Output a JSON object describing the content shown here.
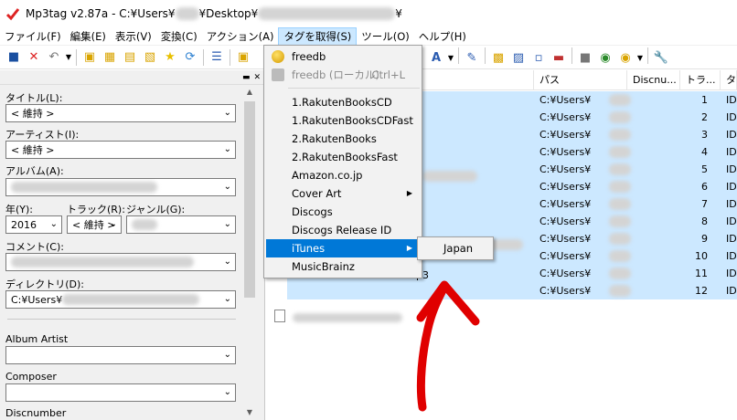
{
  "window": {
    "title": "Mp3tag v2.87a  -  C:¥Users¥",
    "title_mid": "¥Desktop¥",
    "title_end": "¥"
  },
  "menubar": [
    "ファイル(F)",
    "編集(E)",
    "表示(V)",
    "変換(C)",
    "アクション(A)",
    "タグを取得(S)",
    "ツール(O)",
    "ヘルプ(H)"
  ],
  "toolbar": {
    "icons": [
      "save-icon",
      "remove-tag-icon",
      "undo-icon",
      "open-folder-icon",
      "add-folder-icon",
      "favorite-icon",
      "refresh-icon",
      "tag-panel-icon"
    ]
  },
  "left_panel": {
    "title": {
      "label": "タイトル(L):",
      "value": "< 維持 >"
    },
    "artist": {
      "label": "アーティスト(I):",
      "value": "< 維持 >"
    },
    "album": {
      "label": "アルバム(A):",
      "value": ""
    },
    "year": {
      "label": "年(Y):",
      "value": "2016"
    },
    "track": {
      "label": "トラック(R):",
      "value": "< 維持 >"
    },
    "genre": {
      "label": "ジャンル(G):",
      "value": ""
    },
    "comment": {
      "label": "コメント(C):",
      "value": ""
    },
    "directory": {
      "label": "ディレクトリ(D):",
      "value": "C:¥Users¥"
    },
    "album_artist": {
      "label": "Album Artist",
      "value": ""
    },
    "composer": {
      "label": "Composer",
      "value": ""
    },
    "discnumber": {
      "label": "Discnumber"
    }
  },
  "file_list": {
    "columns": [
      "パス",
      "Discnu...",
      "トラ...",
      "タ"
    ],
    "rows": [
      {
        "path": "C:¥Users¥",
        "track": "1",
        "tag": "ID"
      },
      {
        "path": "C:¥Users¥",
        "track": "2",
        "tag": "ID"
      },
      {
        "path": "C:¥Users¥",
        "track": "3",
        "tag": "ID"
      },
      {
        "path": "C:¥Users¥",
        "track": "4",
        "tag": "ID"
      },
      {
        "path": "C:¥Users¥",
        "track": "5",
        "tag": "ID"
      },
      {
        "path": "C:¥Users¥",
        "track": "6",
        "tag": "ID"
      },
      {
        "path": "C:¥Users¥",
        "track": "7",
        "tag": "ID"
      },
      {
        "path": "C:¥Users¥",
        "track": "8",
        "tag": "ID"
      },
      {
        "path": "C:¥Users¥",
        "track": "9",
        "tag": "ID"
      },
      {
        "path": "C:¥Users¥",
        "track": "10",
        "tag": "ID"
      },
      {
        "path": "C:¥Users¥",
        "track": "11",
        "tag": "ID"
      },
      {
        "path": "C:¥Users¥",
        "track": "12",
        "tag": "ID"
      }
    ],
    "filename_fragments": {
      "row7": "3",
      "row11": "p3"
    }
  },
  "tag_sources_menu": {
    "items": [
      {
        "label": "freedb",
        "shortcut": ""
      },
      {
        "label": "freedb (ローカル)",
        "shortcut": "Ctrl+L",
        "disabled": true
      },
      {
        "label": "1.RakutenBooksCD"
      },
      {
        "label": "1.RakutenBooksCDFast"
      },
      {
        "label": "2.RakutenBooks"
      },
      {
        "label": "2.RakutenBooksFast"
      },
      {
        "label": "Amazon.co.jp"
      },
      {
        "label": "Cover Art"
      },
      {
        "label": "Discogs"
      },
      {
        "label": "Discogs Release ID"
      },
      {
        "label": "iTunes"
      },
      {
        "label": "MusicBrainz"
      }
    ],
    "submenu": {
      "label": "Japan"
    }
  },
  "colors": {
    "selection": "#cce8ff",
    "menu_highlight": "#0078d7",
    "annotation": "#e00000"
  }
}
